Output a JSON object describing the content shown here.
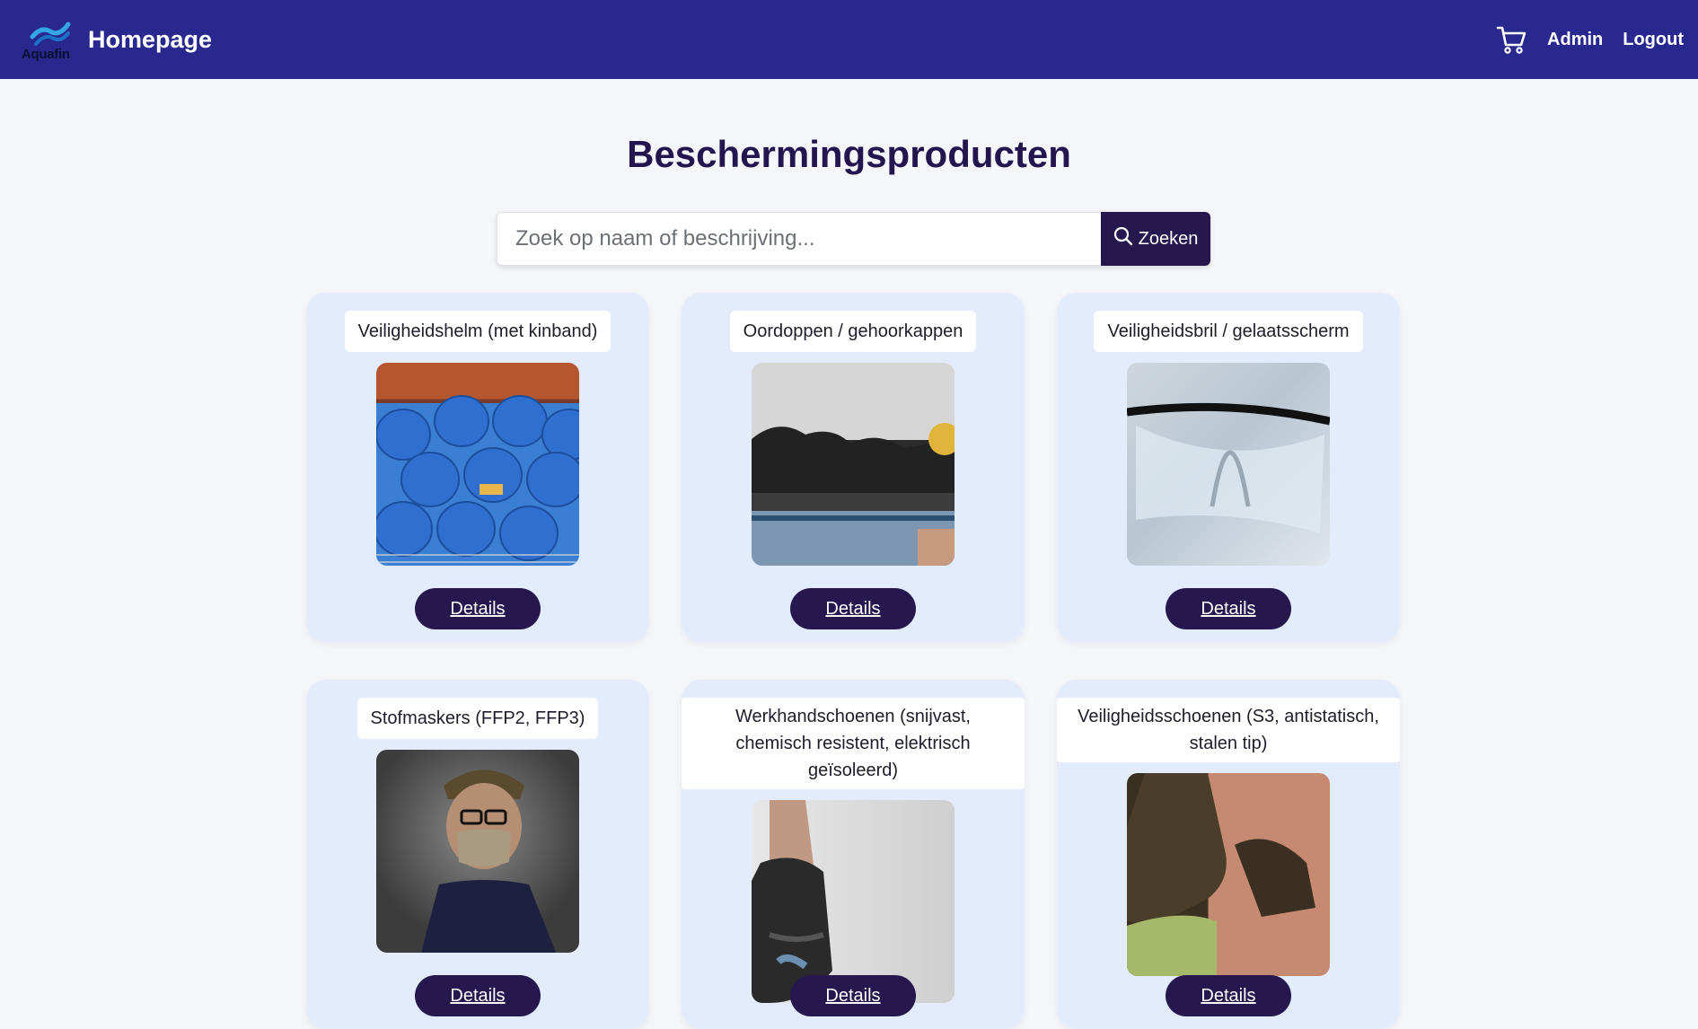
{
  "nav": {
    "logo_text": "Aquafin",
    "title": "Homepage",
    "admin": "Admin",
    "logout": "Logout"
  },
  "page_title": "Beschermingsproducten",
  "search": {
    "placeholder": "Zoek op naam of beschrijving...",
    "button_label": "Zoeken"
  },
  "products": [
    {
      "name": "Veiligheidshelm (met kinband)",
      "details_label": "Details"
    },
    {
      "name": "Oordoppen / gehoorkappen",
      "details_label": "Details"
    },
    {
      "name": "Veiligheidsbril / gelaatsscherm",
      "details_label": "Details"
    },
    {
      "name": "Stofmaskers (FFP2, FFP3)",
      "details_label": "Details"
    },
    {
      "name": "Werkhandschoenen (snijvast, chemisch resistent, elektrisch geïsoleerd)",
      "details_label": "Details"
    },
    {
      "name": "Veiligheidsschoenen (S3, antistatisch, stalen tip)",
      "details_label": "Details"
    }
  ],
  "colors": {
    "navbar": "#28288e",
    "primary_dark": "#26184f",
    "card_bg": "#e3ecfd",
    "page_bg": "#f5f6f9"
  },
  "icons": [
    "aquafin-logo",
    "cart-icon",
    "search-icon"
  ]
}
